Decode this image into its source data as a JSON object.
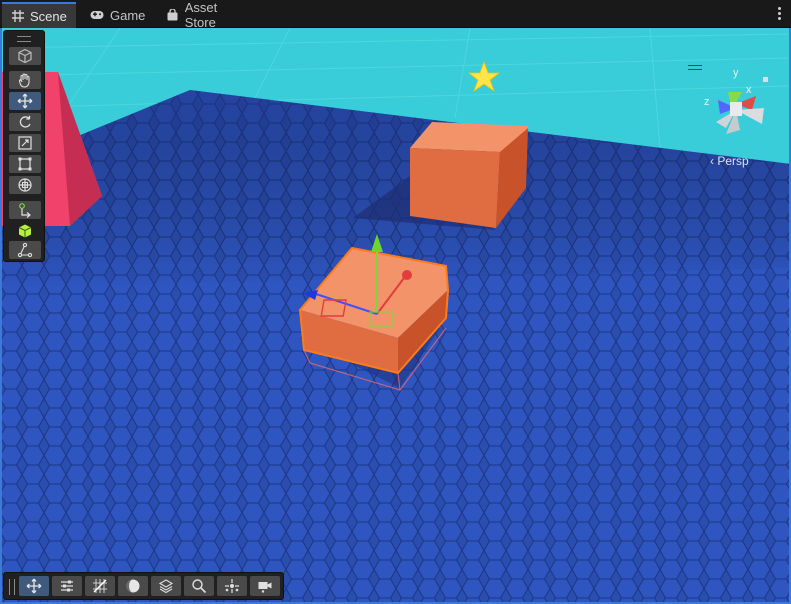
{
  "tabs": [
    {
      "label": "Scene",
      "icon": "grid-icon",
      "active": true
    },
    {
      "label": "Game",
      "icon": "gamepad-icon",
      "active": false
    },
    {
      "label": "Asset Store",
      "icon": "shopping-bag-icon",
      "active": false
    }
  ],
  "tools": [
    {
      "name": "view-options-cube-tool",
      "icon": "cube-outline-icon",
      "active": false
    },
    {
      "name": "hand-tool",
      "icon": "hand-icon",
      "active": false
    },
    {
      "name": "move-tool",
      "icon": "move-arrows-icon",
      "active": true
    },
    {
      "name": "rotate-tool",
      "icon": "rotate-icon",
      "active": false
    },
    {
      "name": "scale-tool",
      "icon": "scale-icon",
      "active": false
    },
    {
      "name": "rect-tool",
      "icon": "rect-icon",
      "active": false
    },
    {
      "name": "transform-tool",
      "icon": "transform-icon",
      "active": false
    },
    {
      "name": "pivot-tool",
      "icon": "pivot-icon",
      "active": false
    },
    {
      "name": "custom-cube-tool",
      "icon": "green-cube-icon",
      "active": false
    },
    {
      "name": "probuilder-tool",
      "icon": "nodes-icon",
      "active": false
    }
  ],
  "bottom_tools": [
    {
      "name": "move-overlay-tool",
      "icon": "move-arrows-icon",
      "active": true
    },
    {
      "name": "sliders-tool",
      "icon": "sliders-icon"
    },
    {
      "name": "grid-snap-tool",
      "icon": "grid-snap-icon"
    },
    {
      "name": "shading-mode-tool",
      "icon": "sphere-icon"
    },
    {
      "name": "layers-tool",
      "icon": "layers-icon"
    },
    {
      "name": "search-tool",
      "icon": "search-icon"
    },
    {
      "name": "pivot-center-tool",
      "icon": "pivot-center-icon"
    },
    {
      "name": "camera-tool",
      "icon": "camera-icon"
    }
  ],
  "gizmo": {
    "axis_y": "y",
    "axis_x": "x",
    "axis_z": "z",
    "projection": "Persp"
  },
  "colors": {
    "accent": "#3a7ad9",
    "floor": "#2748a6",
    "water": "#3ad0db",
    "cube": "#f07a4d",
    "pink_wall": "#f0426b"
  }
}
